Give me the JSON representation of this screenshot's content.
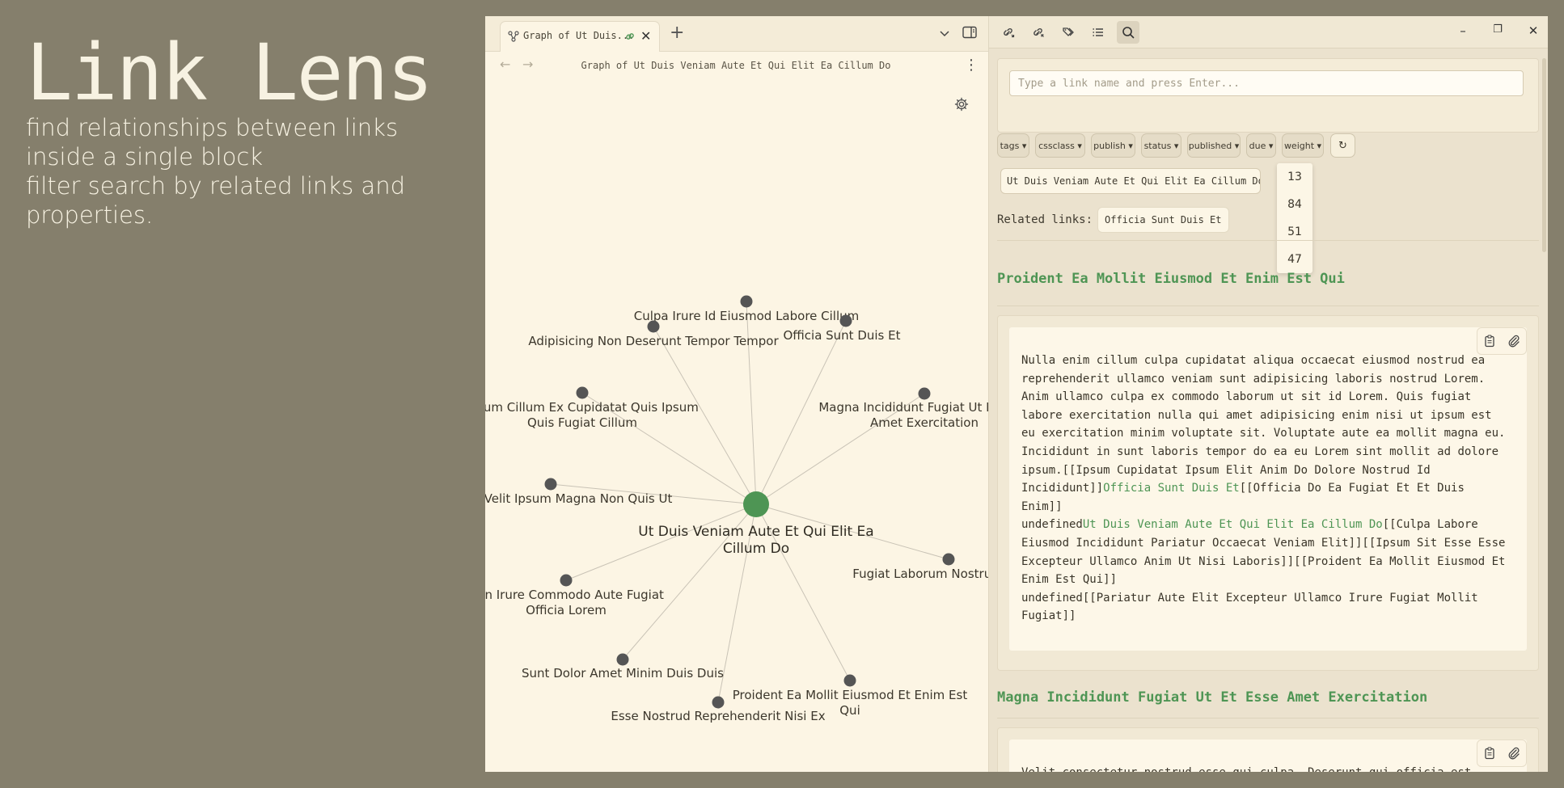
{
  "promo": {
    "brand": "Link Lens",
    "line1": "find relationships between links inside a single block",
    "line2": "filter search by related links and properties."
  },
  "graph_tab": {
    "tab_title": "Graph of Ut Duis...",
    "view_title": "Graph of Ut Duis Veniam Aute Et Qui Elit Ea Cillum Do"
  },
  "graph": {
    "center": "Ut Duis Veniam Aute Et Qui Elit Ea Cillum Do",
    "center_color": "#4e9554",
    "node_color": "#555555",
    "nodes": [
      {
        "label": "Culpa Irure Id Eiusmod Labore Cillum"
      },
      {
        "label": "Officia Sunt Duis Et"
      },
      {
        "label": "Adipisicing Non Deserunt Tempor Tempor"
      },
      {
        "label": "Ipsum Cillum Ex Cupidatat Quis Ipsum Quis Fugiat Cillum"
      },
      {
        "label": "Magna Incididunt Fugiat Ut Et Esse Amet Exercitation"
      },
      {
        "label": "Velit Ipsum Magna Non Quis Ut"
      },
      {
        "label": "Fugiat Laborum Nostrud"
      },
      {
        "label": "Non Irure Commodo Aute Fugiat Officia Lorem"
      },
      {
        "label": "Sunt Dolor Amet Minim Duis Duis"
      },
      {
        "label": "Proident Ea Mollit Eiusmod Et Enim Est Qui"
      },
      {
        "label": "Esse Nostrud Reprehenderit Nisi Ex"
      }
    ]
  },
  "search": {
    "placeholder": "Type a link name and press Enter..."
  },
  "filters": [
    "tags ▾",
    "cssclass ▾",
    "publish ▾",
    "status ▾",
    "published ▾",
    "due ▾",
    "weight ▾"
  ],
  "refresh_glyph": "↻",
  "weight_options": [
    "13",
    "84",
    "51",
    "47"
  ],
  "selected_link": "Ut Duis Veniam Aute Et Qui Elit Ea Cillum Do",
  "remove_glyph": "×",
  "related": {
    "label": "Related links:",
    "links": [
      "Officia Sunt Duis Et"
    ]
  },
  "results": [
    {
      "title": "Proident Ea Mollit Eiusmod Et Enim Est Qui",
      "paragraphs": [
        [
          {
            "t": "Nulla enim cillum culpa cupidatat aliqua occaecat eiusmod nostrud ea reprehenderit ullamco veniam sunt adipisicing laboris nostrud Lorem. Anim ullamco culpa ex commodo laborum ut sit id Lorem. Quis fugiat labore exercitation nulla qui amet adipisicing enim nisi ut ipsum est eu exercitation minim voluptate sit. Voluptate aute ea mollit magna eu. Incididunt in sunt laboris tempor do ea eu Lorem sint mollit ad dolore ipsum.[[Ipsum Cupidatat Ipsum Elit Anim Do Dolore Nostrud Id Incididunt]]"
          },
          {
            "t": "Officia Sunt Duis Et",
            "link": true
          },
          {
            "t": "[[Officia Do Ea Fugiat Et Et Duis Enim]]"
          }
        ],
        [
          {
            "t": "undefined"
          },
          {
            "t": "Ut Duis Veniam Aute Et Qui Elit Ea Cillum Do",
            "link": true
          },
          {
            "t": "[[Culpa Labore Eiusmod Incididunt Pariatur Occaecat Veniam Elit]][[Ipsum Sit Esse Esse Excepteur Ullamco Anim Ut Nisi Laboris]][[Proident Ea Mollit Eiusmod Et Enim Est Qui]]"
          }
        ],
        [
          {
            "t": "undefined[[Pariatur Aute Elit Excepteur Ullamco Irure Fugiat Mollit Fugiat]]"
          }
        ]
      ]
    },
    {
      "title": "Magna Incididunt Fugiat Ut Et Esse Amet Exercitation",
      "paragraphs": [
        [
          {
            "t": "Velit consectetur nostrud esse qui culpa. Deserunt qui officia est irure"
          }
        ]
      ]
    }
  ]
}
